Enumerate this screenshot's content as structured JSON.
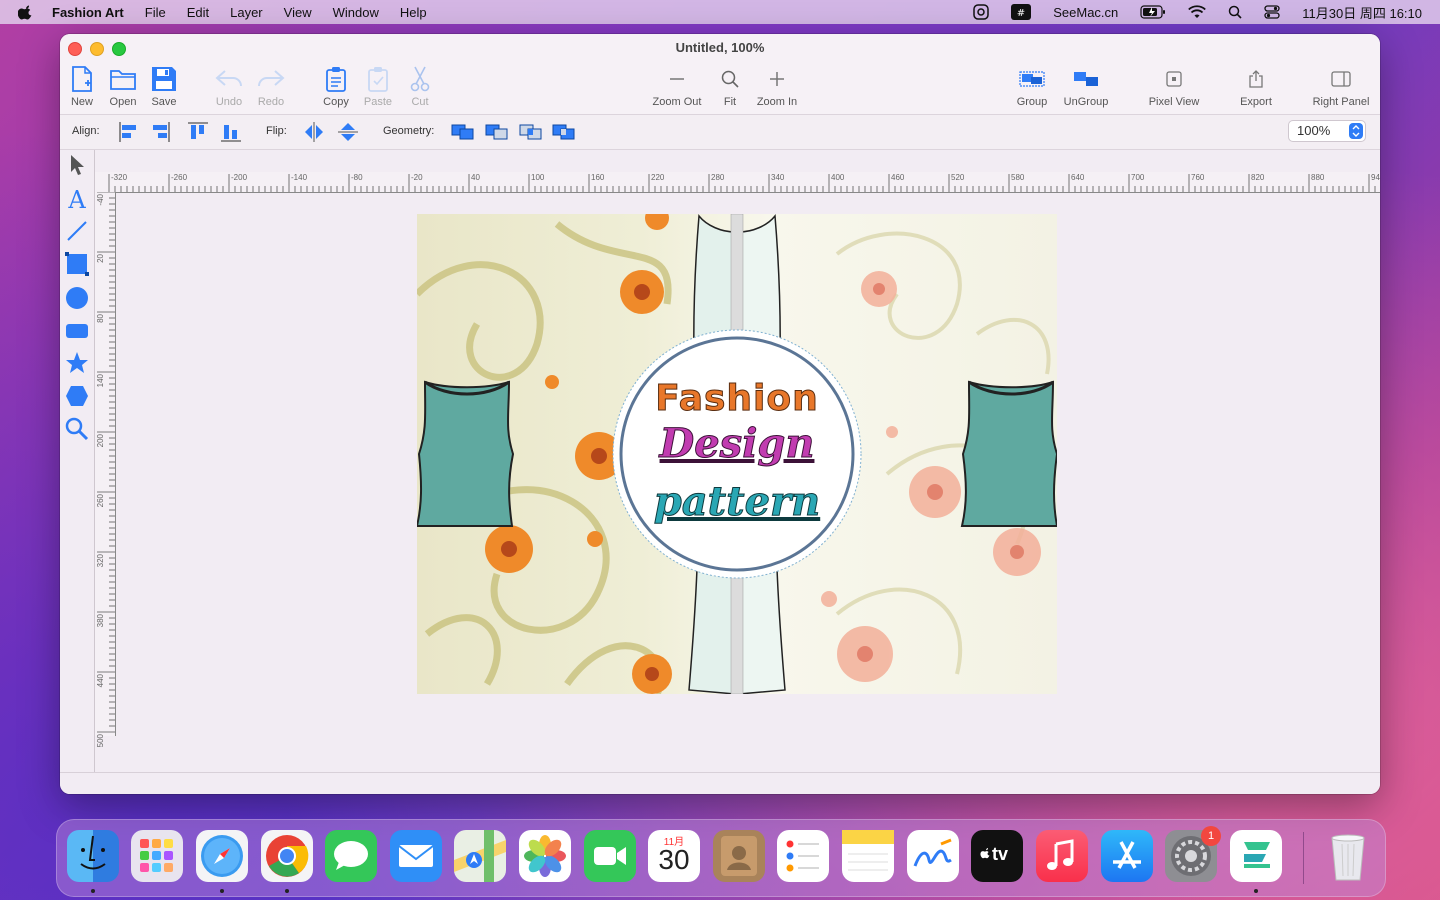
{
  "menubar": {
    "app_name": "Fashion Art",
    "menus": [
      "File",
      "Edit",
      "Layer",
      "View",
      "Window",
      "Help"
    ],
    "website": "SeeMac.cn",
    "clock": "11月30日 周四 16:10"
  },
  "window": {
    "title": "Untitled, 100%",
    "toolbar": {
      "new": "New",
      "open": "Open",
      "save": "Save",
      "undo": "Undo",
      "redo": "Redo",
      "copy": "Copy",
      "paste": "Paste",
      "cut": "Cut",
      "zoom_out": "Zoom Out",
      "fit": "Fit",
      "zoom_in": "Zoom In",
      "group": "Group",
      "ungroup": "UnGroup",
      "pixel_view": "Pixel View",
      "export": "Export",
      "right_panel": "Right Panel"
    },
    "options": {
      "align_label": "Align:",
      "flip_label": "Flip:",
      "geometry_label": "Geometry:",
      "zoom_value": "100%"
    }
  },
  "rulers": {
    "h_ticks": [
      "-320",
      "-260",
      "-200",
      "-140",
      "-80",
      "-20",
      "40",
      "100",
      "160",
      "220",
      "280",
      "340",
      "400",
      "460",
      "520",
      "580",
      "640",
      "700",
      "760",
      "820",
      "880",
      "940"
    ],
    "v_ticks": [
      "-40",
      "20",
      "80",
      "140",
      "200",
      "260",
      "320",
      "380",
      "440",
      "500"
    ]
  },
  "artboard": {
    "line1": "Fashion",
    "line2": "Design",
    "line3": "pattern"
  },
  "dock": {
    "calendar_month": "11月",
    "calendar_day": "30",
    "settings_badge": "1",
    "tv_label": "tv"
  },
  "colors": {
    "accent": "#2f7cf6",
    "shirt": "#5fa9a0",
    "title_orange": "#e8772a",
    "title_magenta": "#c13cb0",
    "title_teal": "#2aa7b4"
  }
}
